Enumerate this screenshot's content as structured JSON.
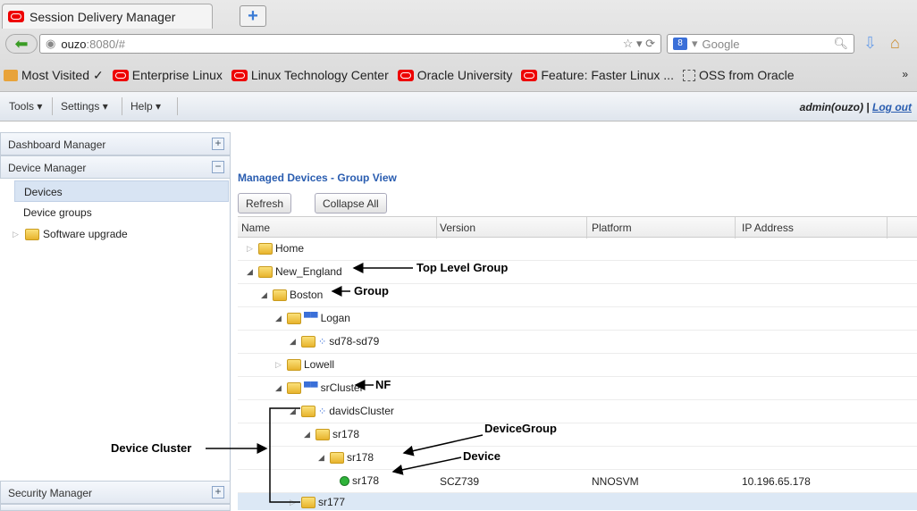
{
  "browser": {
    "tab_title": "Session Delivery Manager",
    "new_tab": "+",
    "url_host": "ouzo",
    "url_rest": ":8080/#",
    "search_placeholder": "Google",
    "bookmarks": [
      {
        "label": "Most Visited",
        "icon": "folder-icon",
        "suffix": "✓"
      },
      {
        "label": "Enterprise Linux",
        "icon": "oracle-icon"
      },
      {
        "label": "Linux Technology Center",
        "icon": "oracle-icon"
      },
      {
        "label": "Oracle University",
        "icon": "oracle-icon"
      },
      {
        "label": "Feature: Faster Linux ...",
        "icon": "oracle-icon"
      },
      {
        "label": "OSS from Oracle",
        "icon": "dashed-box-icon"
      }
    ],
    "more": "»"
  },
  "toolbar": {
    "tools": "Tools ▾",
    "settings": "Settings ▾",
    "help": "Help ▾",
    "user": "admin(ouzo) | ",
    "logout": "Log out"
  },
  "sidebar": {
    "sections": [
      {
        "label": "Dashboard Manager",
        "toggle": "+"
      },
      {
        "label": "Device Manager",
        "toggle": "−"
      },
      {
        "label": "Security Manager",
        "toggle": "+"
      }
    ],
    "items": [
      "Devices",
      "Device groups",
      "Software upgrade"
    ]
  },
  "main": {
    "title": "Managed Devices - Group View",
    "refresh": "Refresh",
    "collapse_all": "Collapse All",
    "columns": [
      "Name",
      "Version",
      "Platform",
      "IP Address"
    ],
    "rows": [
      {
        "name": "Home",
        "expanded": false,
        "type": "folder"
      },
      {
        "name": "New_England",
        "expanded": true,
        "type": "folder"
      },
      {
        "name": "Boston",
        "expanded": true,
        "type": "folder"
      },
      {
        "name": "Logan",
        "expanded": true,
        "type": "nf"
      },
      {
        "name": "sd78-sd79",
        "expanded": true,
        "type": "cluster"
      },
      {
        "name": "Lowell",
        "expanded": false,
        "type": "folder"
      },
      {
        "name": "srCluster",
        "expanded": true,
        "type": "nf"
      },
      {
        "name": "davidsCluster",
        "expanded": true,
        "type": "cluster"
      },
      {
        "name": "sr178",
        "expanded": true,
        "type": "folder"
      },
      {
        "name": "sr178",
        "expanded": true,
        "type": "folder"
      },
      {
        "name": "sr178",
        "type": "device",
        "version": "SCZ739",
        "platform": "NNOSVM",
        "ip": "10.196.65.178"
      },
      {
        "name": "sr177",
        "expanded": false,
        "type": "folder"
      }
    ]
  },
  "annotations": {
    "top_level_group": "Top Level Group",
    "group": "Group",
    "nf": "NF",
    "device_group": "DeviceGroup",
    "device": "Device",
    "device_cluster": "Device Cluster"
  }
}
